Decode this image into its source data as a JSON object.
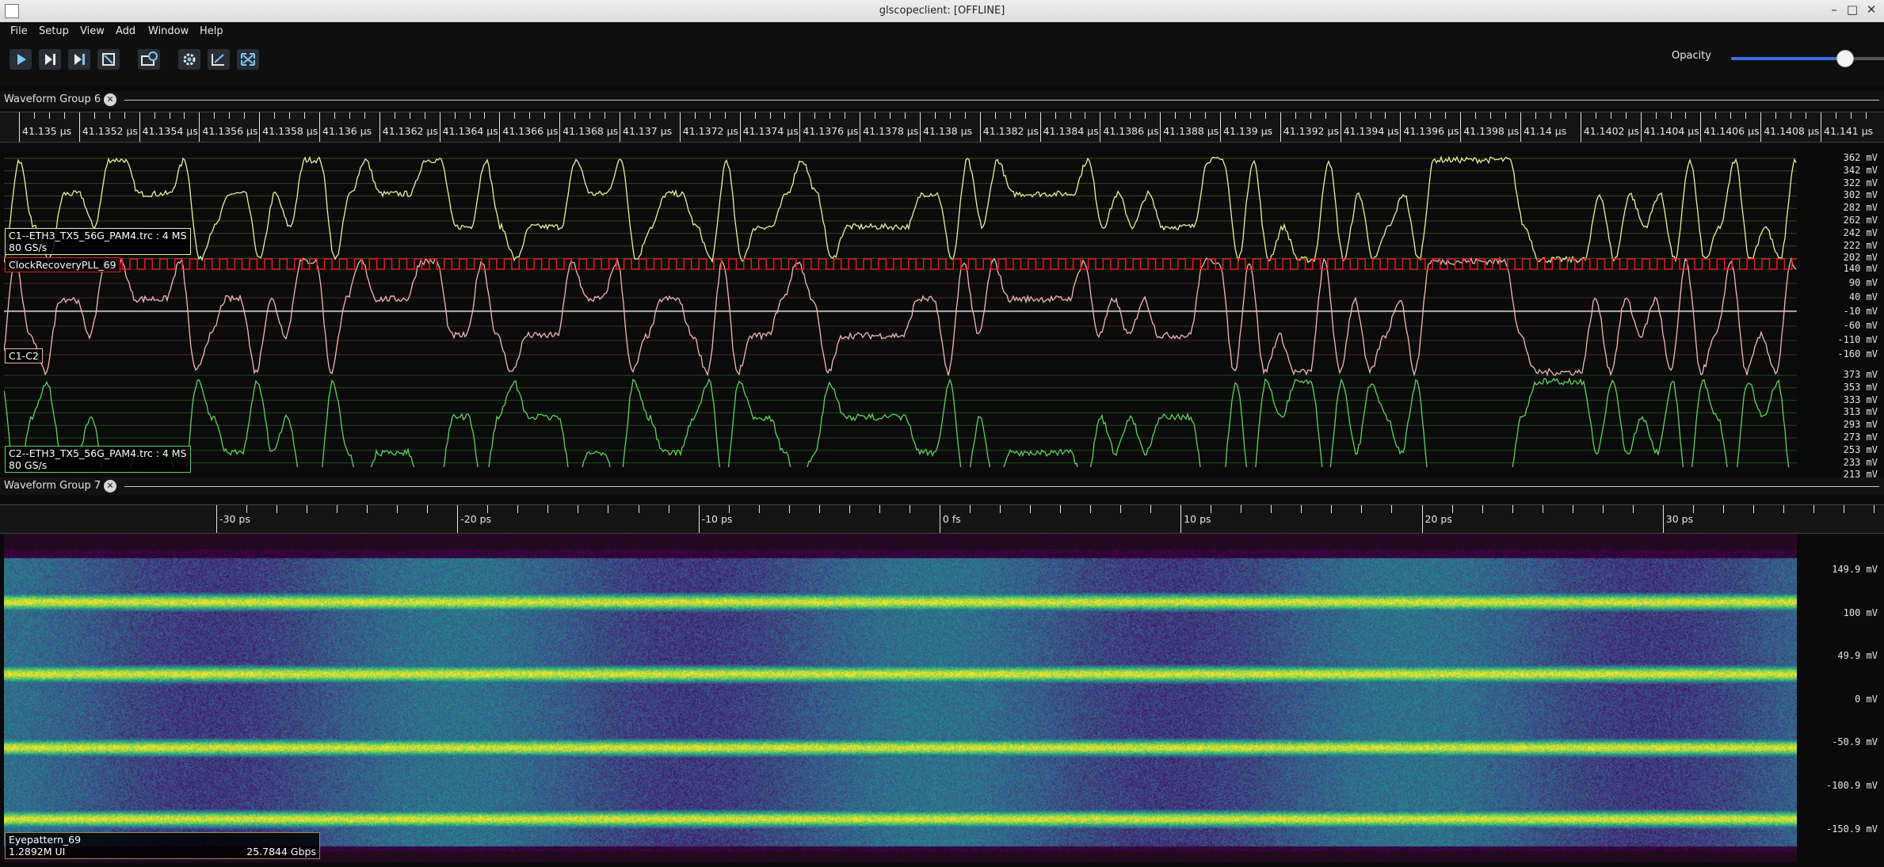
{
  "window": {
    "title": "glscopeclient: [OFFLINE]",
    "controls": [
      "minimize-icon",
      "maximize-icon",
      "close-icon"
    ]
  },
  "menu": [
    "File",
    "Setup",
    "View",
    "Add",
    "Window",
    "Help"
  ],
  "toolbar": {
    "buttons": [
      "start-icon",
      "single-trigger-icon",
      "force-trigger-icon",
      "stop-icon",
      "history-icon",
      "preferences-icon",
      "clear-sweeps-icon",
      "fullscreen-icon"
    ],
    "opacity_label": "Opacity",
    "opacity_value": 0.72
  },
  "group6": {
    "title": "Waveform Group 6",
    "timeline": [
      "41.135 µs",
      "41.1352 µs",
      "41.1354 µs",
      "41.1356 µs",
      "41.1358 µs",
      "41.136 µs",
      "41.1362 µs",
      "41.1364 µs",
      "41.1366 µs",
      "41.1368 µs",
      "41.137 µs",
      "41.1372 µs",
      "41.1374 µs",
      "41.1376 µs",
      "41.1378 µs",
      "41.138 µs",
      "41.1382 µs",
      "41.1384 µs",
      "41.1386 µs",
      "41.1388 µs",
      "41.139 µs",
      "41.1392 µs",
      "41.1394 µs",
      "41.1396 µs",
      "41.1398 µs",
      "41.14 µs",
      "41.1402 µs",
      "41.1404 µs",
      "41.1406 µs",
      "41.1408 µs",
      "41.141 µs"
    ],
    "channels": [
      {
        "name": "C1--ETH3_TX5_56G_PAM4.trc : 4 MS",
        "rate": "80 GS/s",
        "color": "#e6f0a0",
        "axis": [
          "362 mV",
          "342 mV",
          "322 mV",
          "302 mV",
          "282 mV",
          "262 mV",
          "242 mV",
          "222 mV",
          "202 mV"
        ]
      },
      {
        "name": "ClockRecoveryPLL_69",
        "color": "#e02020"
      },
      {
        "name": "C1-C2",
        "color": "#f0b8b8",
        "axis": [
          "140 mV",
          "90 mV",
          "40 mV",
          "-10 mV",
          "-60 mV",
          "-110 mV",
          "-160 mV"
        ]
      },
      {
        "name": "C2--ETH3_TX5_56G_PAM4.trc : 4 MS",
        "rate": "80 GS/s",
        "color": "#60d060",
        "axis": [
          "373 mV",
          "353 mV",
          "333 mV",
          "313 mV",
          "293 mV",
          "273 mV",
          "253 mV",
          "233 mV",
          "213 mV"
        ]
      }
    ]
  },
  "group7": {
    "title": "Waveform Group 7",
    "timeline": [
      "-30 ps",
      "-20 ps",
      "-10 ps",
      "0 fs",
      "10 ps",
      "20 ps",
      "30 ps"
    ],
    "eye": {
      "name": "Eyepattern_69",
      "ui_count": "1.2892M UI",
      "rate": "25.7844 Gbps",
      "axis": [
        "149.9 mV",
        "100 mV",
        "49.9 mV",
        "0 mV",
        "-50.9 mV",
        "-100.9 mV",
        "-150.9 mV"
      ]
    }
  }
}
